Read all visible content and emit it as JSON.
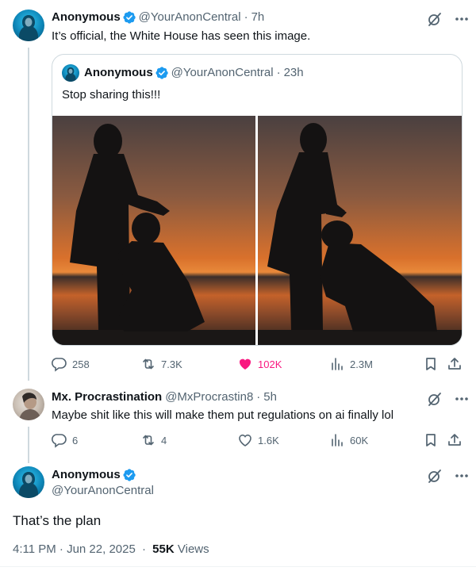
{
  "tweet1": {
    "name": "Anonymous",
    "handle": "@YourAnonCentral",
    "time": "7h",
    "text": "It’s official, the White House has seen this image.",
    "quote": {
      "name": "Anonymous",
      "handle": "@YourAnonCentral",
      "time": "23h",
      "text": "Stop sharing this!!!"
    },
    "stats": {
      "replies": "258",
      "reposts": "7.3K",
      "likes": "102K",
      "views": "2.3M"
    }
  },
  "reply1": {
    "name": "Mx. Procrastination",
    "handle": "@MxProcrastin8",
    "time": "5h",
    "text": "Maybe shit like this will make them put regulations on ai finally lol",
    "stats": {
      "replies": "6",
      "reposts": "4",
      "likes": "1.6K",
      "views": "60K"
    }
  },
  "reply2": {
    "name": "Anonymous",
    "handle": "@YourAnonCentral",
    "text": "That’s the plan",
    "timestamp": "4:11 PM · Jun 22, 2025",
    "views_count": "55K",
    "views_label": "Views"
  },
  "colors": {
    "verified": "#1d9bf0",
    "like": "#f91880",
    "muted": "#536471",
    "border": "#cfd9de"
  },
  "icons": [
    "verified-badge-icon",
    "grok-icon",
    "more-icon",
    "reply-icon",
    "repost-icon",
    "like-icon",
    "views-icon",
    "bookmark-icon",
    "share-icon"
  ]
}
